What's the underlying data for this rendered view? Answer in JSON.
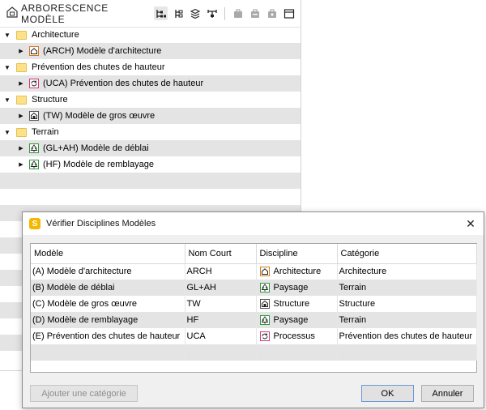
{
  "tree": {
    "title": "ARBORESCENCE MODÈLE",
    "groups": [
      {
        "label": "Architecture",
        "items": [
          {
            "label": "(ARCH) Modèle d'architecture",
            "icon": "house-icon"
          }
        ]
      },
      {
        "label": "Prévention des chutes de hauteur",
        "items": [
          {
            "label": "(UCA) Prévention des chutes de hauteur",
            "icon": "process-icon"
          }
        ]
      },
      {
        "label": "Structure",
        "items": [
          {
            "label": "(TW) Modèle de gros œuvre",
            "icon": "structure-icon"
          }
        ]
      },
      {
        "label": "Terrain",
        "items": [
          {
            "label": "(GL+AH) Modèle de déblai",
            "icon": "tree-icon"
          },
          {
            "label": "(HF) Modèle de remblayage",
            "icon": "tree-icon"
          }
        ]
      }
    ]
  },
  "dialog": {
    "title": "Vérifier Disciplines Modèles",
    "app_icon_letter": "S",
    "columns": [
      "Modèle",
      "Nom Court",
      "Discipline",
      "Catégorie"
    ],
    "rows": [
      {
        "model": "(A) Modèle d'architecture",
        "short": "ARCH",
        "discipline": "Architecture",
        "category": "Architecture"
      },
      {
        "model": "(B) Modèle de déblai",
        "short": "GL+AH",
        "discipline": "Paysage",
        "category": "Terrain"
      },
      {
        "model": "(C) Modèle de gros œuvre",
        "short": "TW",
        "discipline": "Structure",
        "category": "Structure"
      },
      {
        "model": "(D) Modèle de remblayage",
        "short": "HF",
        "discipline": "Paysage",
        "category": "Terrain"
      },
      {
        "model": "(E) Prévention des chutes de hauteur",
        "short": "UCA",
        "discipline": "Processus",
        "category": "Prévention des chutes de hauteur"
      }
    ],
    "buttons": {
      "add_category": "Ajouter une catégorie",
      "ok": "OK",
      "cancel": "Annuler"
    }
  },
  "colors": {
    "folder": "#fde08a",
    "accent": "#f5b800",
    "row_alt": "#e4e4e4",
    "icon_orange": "#d9771e",
    "icon_green": "#2e9b3a",
    "icon_pink": "#d23a7a"
  }
}
